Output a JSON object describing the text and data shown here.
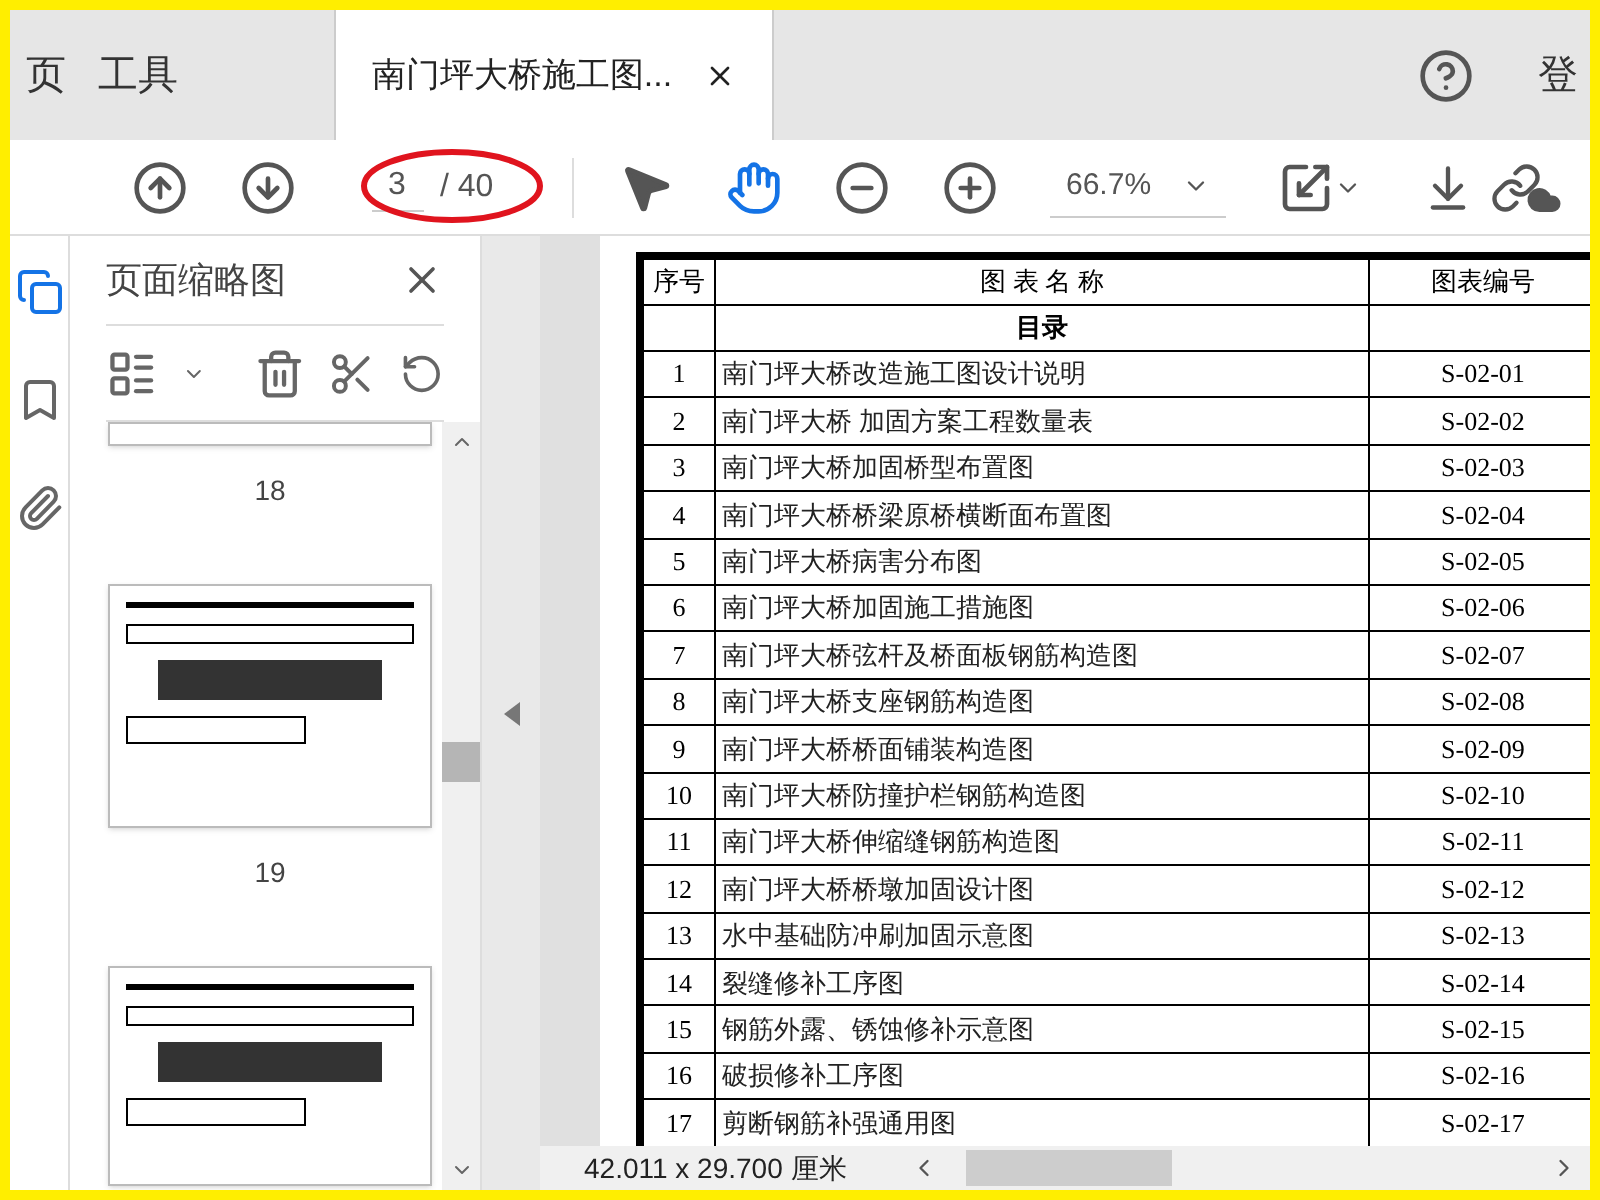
{
  "tabs": [
    {
      "label": "页",
      "selected": false
    },
    {
      "label": "工具",
      "selected": false
    },
    {
      "label": "南门坪大桥施工图...",
      "selected": true
    }
  ],
  "account": {
    "label": "登"
  },
  "toolbar": {
    "page_current": "3",
    "page_total": "/ 40",
    "zoom": "66.7%",
    "tools": [
      {
        "kind": "select",
        "selected": false
      },
      {
        "kind": "hand",
        "selected": true
      }
    ]
  },
  "side_tabs": [
    {
      "kind": "pages",
      "selected": true
    },
    {
      "kind": "bookmarks",
      "selected": false
    },
    {
      "kind": "attachments",
      "selected": false
    }
  ],
  "panel": {
    "title": "页面缩略图",
    "thumbnails": [
      "18",
      "19"
    ]
  },
  "table": {
    "columns": [
      "序号",
      "图 表 名 称",
      "图表编号"
    ],
    "section": "目录",
    "rows": [
      {
        "no": "1",
        "name": "南门坪大桥改造施工图设计说明",
        "code": "S-02-01"
      },
      {
        "no": "2",
        "name": "南门坪大桥 加固方案工程数量表",
        "code": "S-02-02"
      },
      {
        "no": "3",
        "name": "南门坪大桥加固桥型布置图",
        "code": "S-02-03"
      },
      {
        "no": "4",
        "name": "南门坪大桥桥梁原桥横断面布置图",
        "code": "S-02-04"
      },
      {
        "no": "5",
        "name": "南门坪大桥病害分布图",
        "code": "S-02-05"
      },
      {
        "no": "6",
        "name": "南门坪大桥加固施工措施图",
        "code": "S-02-06"
      },
      {
        "no": "7",
        "name": "南门坪大桥弦杆及桥面板钢筋构造图",
        "code": "S-02-07"
      },
      {
        "no": "8",
        "name": "南门坪大桥支座钢筋构造图",
        "code": "S-02-08"
      },
      {
        "no": "9",
        "name": "南门坪大桥桥面铺装构造图",
        "code": "S-02-09"
      },
      {
        "no": "10",
        "name": "南门坪大桥防撞护栏钢筋构造图",
        "code": "S-02-10"
      },
      {
        "no": "11",
        "name": "南门坪大桥伸缩缝钢筋构造图",
        "code": "S-02-11"
      },
      {
        "no": "12",
        "name": "南门坪大桥桥墩加固设计图",
        "code": "S-02-12"
      },
      {
        "no": "13",
        "name": "水中基础防冲刷加固示意图",
        "code": "S-02-13"
      },
      {
        "no": "14",
        "name": "裂缝修补工序图",
        "code": "S-02-14"
      },
      {
        "no": "15",
        "name": "钢筋外露、锈蚀修补示意图",
        "code": "S-02-15"
      },
      {
        "no": "16",
        "name": "破损修补工序图",
        "code": "S-02-16"
      },
      {
        "no": "17",
        "name": "剪断钢筋补强通用图",
        "code": "S-02-17"
      }
    ]
  },
  "status": {
    "size": "42.011 x 29.700 厘米"
  }
}
